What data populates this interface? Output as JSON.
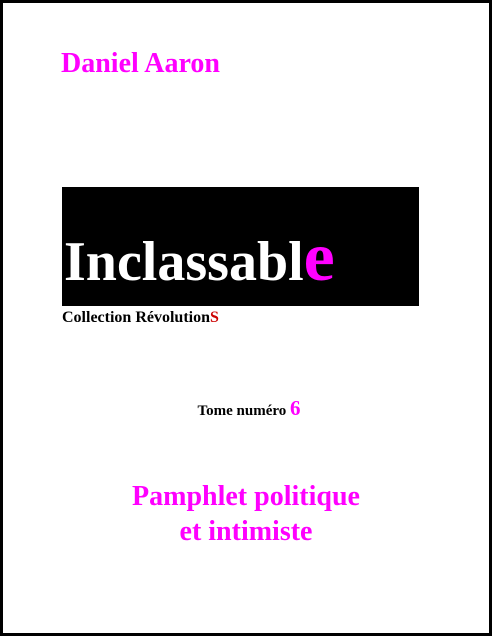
{
  "cover": {
    "author": "Daniel Aaron",
    "title_main": "Inclassabl",
    "title_last_letter": "e",
    "collection_main": "Collection Révolution",
    "collection_last_letter": "S",
    "tome_label": "Tome numéro",
    "tome_number": "6",
    "subtitle_line1": "Pamphlet politique",
    "subtitle_line2": "et intimiste"
  },
  "colors": {
    "accent": "#ff00ff",
    "red": "#cc0000",
    "title_bg": "#000000",
    "title_text": "#ffffff"
  }
}
